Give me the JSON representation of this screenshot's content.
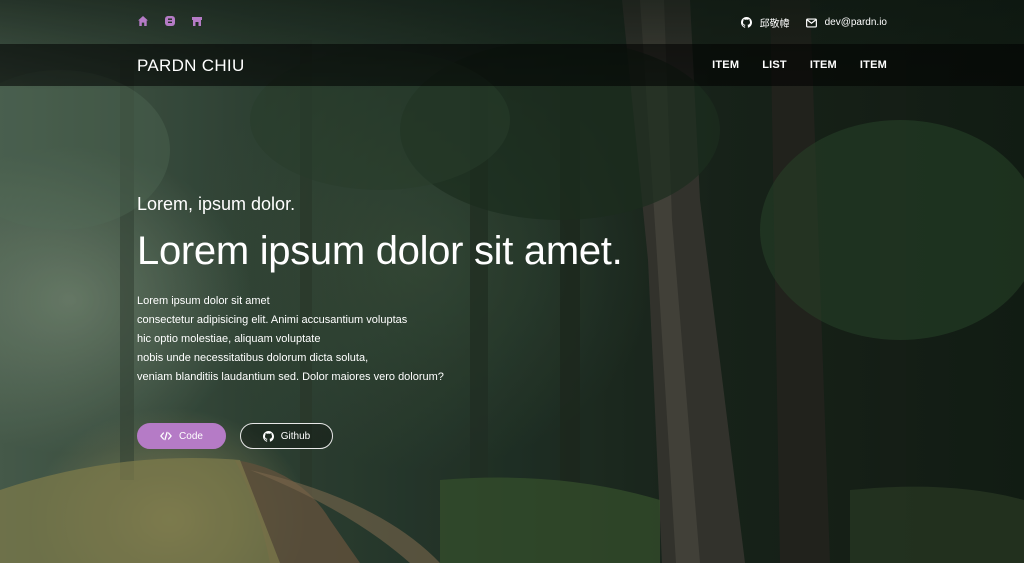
{
  "colors": {
    "accent": "#b57bc6",
    "navbar_bg": "rgba(0,0,0,0.55)"
  },
  "topbar": {
    "social_icons": [
      "home-icon",
      "blog-icon",
      "shop-icon"
    ],
    "contacts": [
      {
        "icon": "github-icon",
        "text": "邱敬幃"
      },
      {
        "icon": "mail-icon",
        "text": "dev@pardn.io"
      }
    ]
  },
  "navbar": {
    "brand": "PARDN CHIU",
    "menu": [
      "ITEM",
      "LIST",
      "ITEM",
      "ITEM"
    ]
  },
  "hero": {
    "eyebrow": "Lorem, ipsum dolor.",
    "headline": "Lorem ipsum dolor sit amet.",
    "description": [
      "Lorem ipsum dolor sit amet",
      "consectetur adipisicing elit. Animi accusantium voluptas",
      "hic optio molestiae, aliquam voluptate",
      "nobis unde necessitatibus dolorum dicta soluta,",
      "veniam blanditiis laudantium sed. Dolor maiores vero dolorum?"
    ],
    "buttons": {
      "code": {
        "label": "Code",
        "icon": "code-icon"
      },
      "github": {
        "label": "Github",
        "icon": "github-icon"
      }
    }
  }
}
